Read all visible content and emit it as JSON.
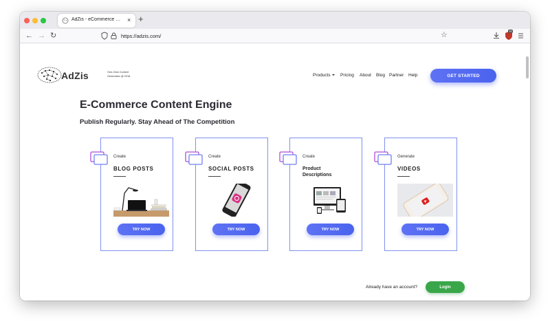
{
  "browser": {
    "tab_title": "AdZis - eCommerce Content Engine",
    "tab_close": "×",
    "new_tab": "+",
    "url": "https://adzis.com/",
    "back": "←",
    "forward": "→",
    "reload": "↻",
    "star": "☆",
    "extension_badge": "30"
  },
  "header": {
    "logo_text": "AdZis",
    "tagline_line1": "One-Click Content",
    "tagline_line2": "Generation @ 2018",
    "menu": [
      "Products",
      "Pricing",
      "About",
      "Blog",
      "Partner",
      "Help"
    ],
    "cta": "GET STARTED"
  },
  "hero": {
    "title": "E-Commerce Content Engine",
    "subtitle": "Publish Regularly. Stay Ahead of The Competition"
  },
  "cards": [
    {
      "verb": "Create",
      "title": "BLOG POSTS",
      "button": "TRY NOW"
    },
    {
      "verb": "Create",
      "title": "SOCIAL POSTS",
      "button": "TRY NOW"
    },
    {
      "verb": "Create",
      "title_line1": "Product",
      "title_line2": "Descriptions",
      "button": "TRY NOW"
    },
    {
      "verb": "Generate",
      "title": "VIDEOS",
      "button": "TRY NOW"
    }
  ],
  "footer": {
    "account_text": "Already have an account?",
    "login": "Login"
  },
  "colors": {
    "accent": "#5e72f4",
    "login_green": "#3aa64a",
    "card_border": "#7f8ff0",
    "icon_purple": "#b14bd8"
  }
}
